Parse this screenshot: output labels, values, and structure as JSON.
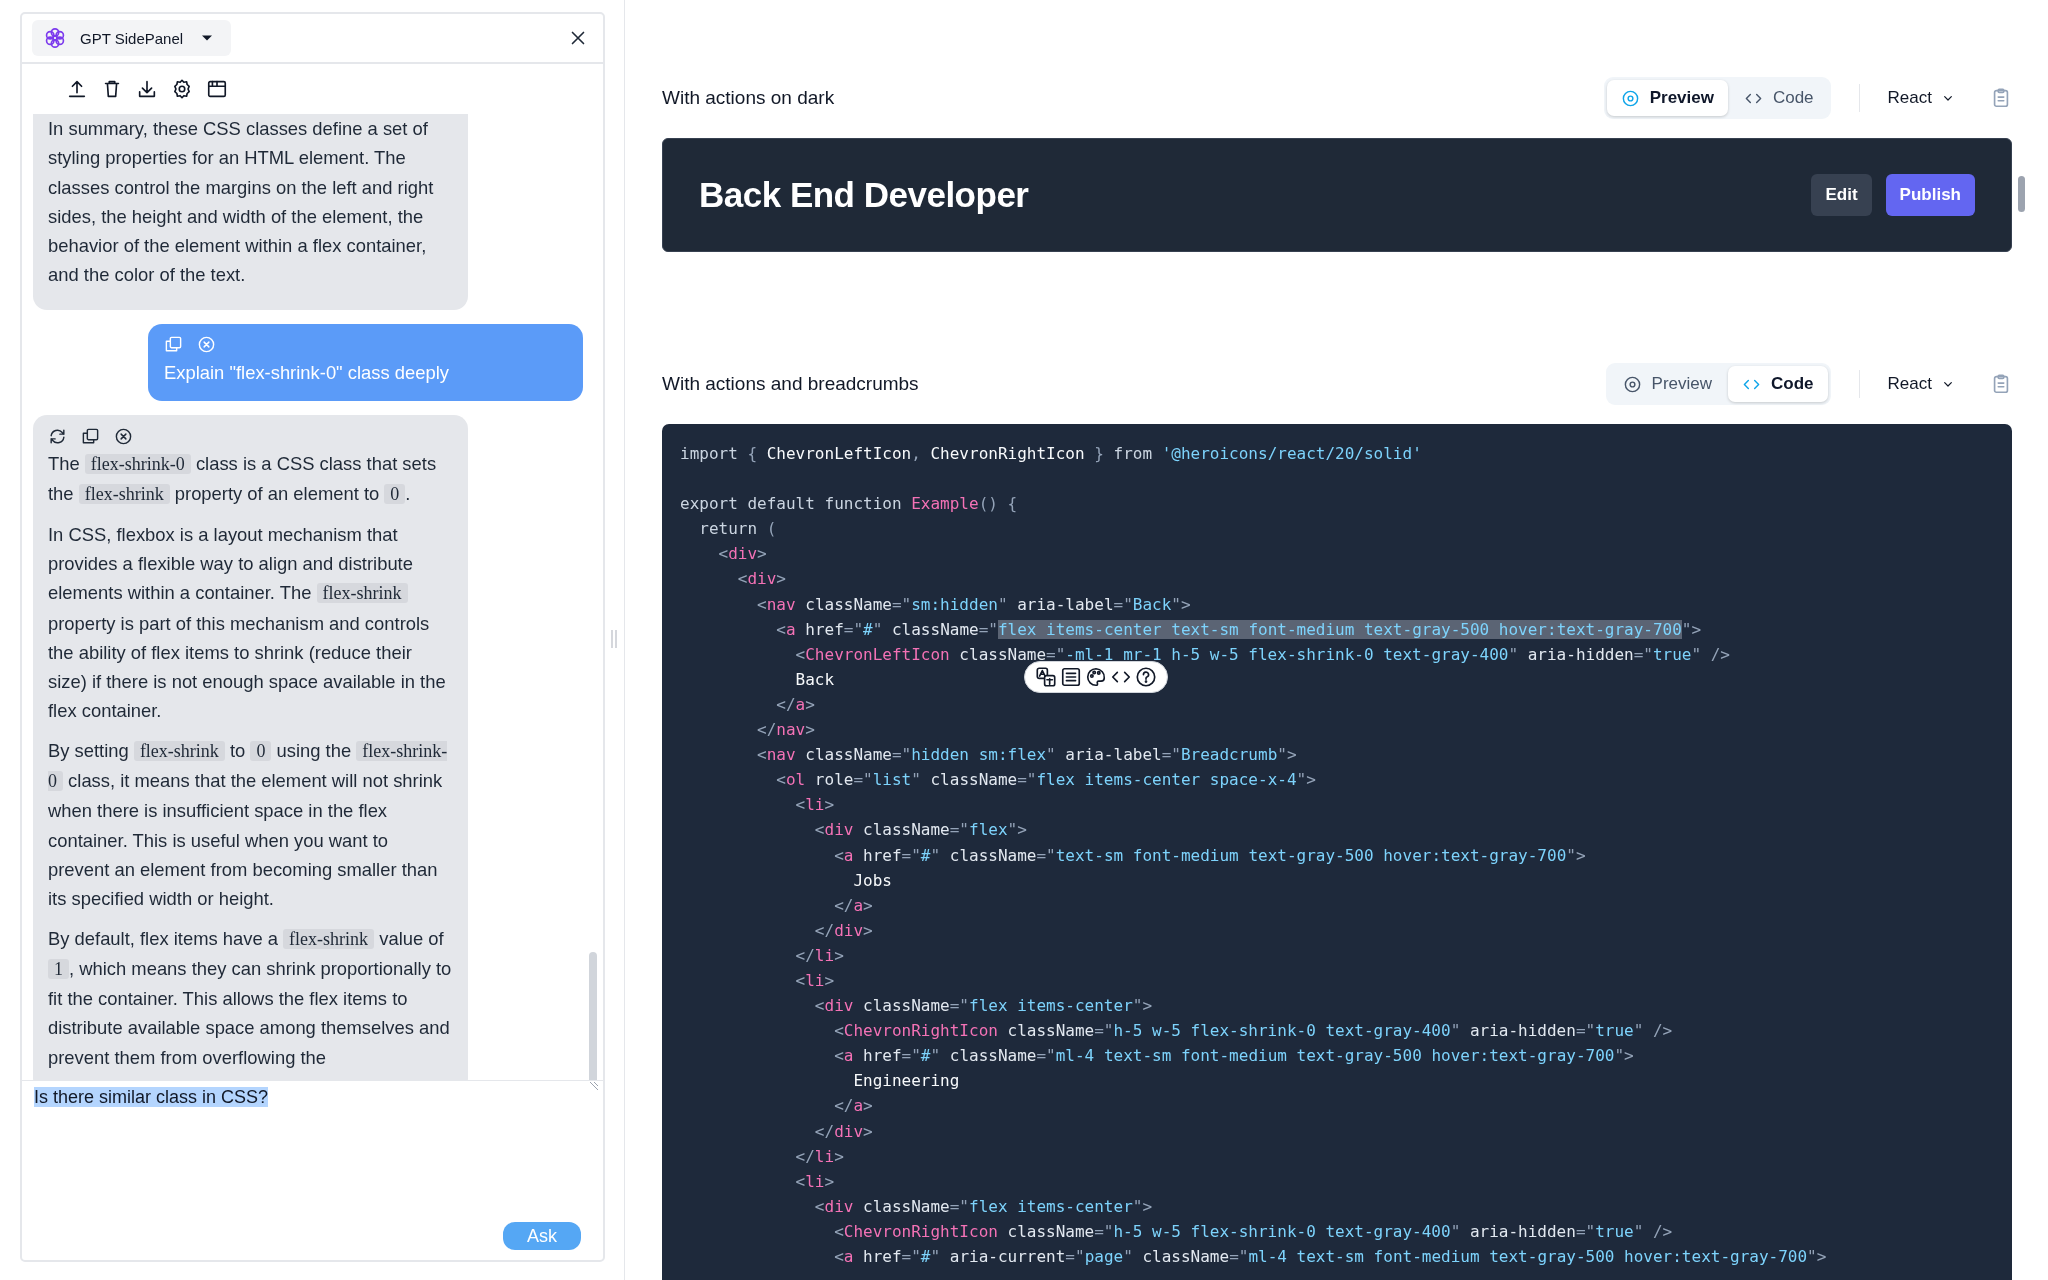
{
  "panel": {
    "title": "GPT SidePanel",
    "messages": [
      {
        "kind": "assistant",
        "cut_off_top": true,
        "paragraphs": [
          [
            {
              "kind": "text",
              "text": "In summary, these CSS classes define a set of styling properties for an HTML element. The classes control the margins on the left and right sides, the height and width of the element, the behavior of the element within a flex container, and the color of the text."
            }
          ]
        ]
      },
      {
        "kind": "user",
        "cut_off_top": false,
        "paragraphs": [
          [
            {
              "kind": "text",
              "text": "Explain \"flex-shrink-0\" class deeply"
            }
          ]
        ]
      },
      {
        "kind": "assistant",
        "cut_off_top": false,
        "paragraphs": [
          [
            {
              "kind": "text",
              "text": "The "
            },
            {
              "kind": "code",
              "text": "flex-shrink-0"
            },
            {
              "kind": "text",
              "text": " class is a CSS class that sets the "
            },
            {
              "kind": "code",
              "text": "flex-shrink"
            },
            {
              "kind": "text",
              "text": " property of an element to "
            },
            {
              "kind": "code",
              "text": "0"
            },
            {
              "kind": "text",
              "text": "."
            }
          ],
          [
            {
              "kind": "text",
              "text": "In CSS, flexbox is a layout mechanism that provides a flexible way to align and distribute elements within a container. The "
            },
            {
              "kind": "code",
              "text": "flex-shrink"
            },
            {
              "kind": "text",
              "text": " property is part of this mechanism and controls the ability of flex items to shrink (reduce their size) if there is not enough space available in the flex container."
            }
          ],
          [
            {
              "kind": "text",
              "text": "By setting "
            },
            {
              "kind": "code",
              "text": "flex-shrink"
            },
            {
              "kind": "text",
              "text": " to "
            },
            {
              "kind": "code",
              "text": "0"
            },
            {
              "kind": "text",
              "text": " using the "
            },
            {
              "kind": "code",
              "text": "flex-shrink-0"
            },
            {
              "kind": "text",
              "text": " class, it means that the element will not shrink when there is insufficient space in the flex container. This is useful when you want to prevent an element from becoming smaller than its specified width or height."
            }
          ],
          [
            {
              "kind": "text",
              "text": "By default, flex items have a "
            },
            {
              "kind": "code",
              "text": "flex-shrink"
            },
            {
              "kind": "text",
              "text": " value of "
            },
            {
              "kind": "code",
              "text": "1"
            },
            {
              "kind": "text",
              "text": ", which means they can shrink proportionally to fit the container. This allows the flex items to distribute available space among themselves and prevent them from overflowing the"
            }
          ]
        ]
      }
    ],
    "input": {
      "value": "Is there similar class in CSS?",
      "value_selected": true
    },
    "ask_button": "Ask"
  },
  "sections": [
    {
      "title": "With actions on dark",
      "kind": "preview",
      "tabs": [
        {
          "label": "Preview",
          "selected": true
        },
        {
          "label": "Code",
          "selected": false
        }
      ],
      "framework": "React",
      "preview": {
        "heading": "Back End Developer",
        "buttons": [
          {
            "label": "Edit",
            "kind": "secondary"
          },
          {
            "label": "Publish",
            "kind": "primary"
          }
        ]
      }
    },
    {
      "title": "With actions and breadcrumbs",
      "kind": "code",
      "tabs": [
        {
          "label": "Preview",
          "selected": false
        },
        {
          "label": "Code",
          "selected": true
        }
      ],
      "framework": "React",
      "code_blocks": [
        [
          [
            {
              "kind": "kw",
              "text": "import"
            },
            {
              "kind": "p",
              "text": " { "
            },
            {
              "kind": "id",
              "text": "ChevronLeftIcon"
            },
            {
              "kind": "p",
              "text": ", "
            },
            {
              "kind": "id",
              "text": "ChevronRightIcon"
            },
            {
              "kind": "p",
              "text": " } "
            },
            {
              "kind": "kw",
              "text": "from "
            },
            {
              "kind": "str",
              "text": "'@heroicons/react/20/solid'"
            }
          ]
        ],
        [
          [
            {
              "kind": "kw",
              "text": "export default function "
            },
            {
              "kind": "fn",
              "text": "Example"
            },
            {
              "kind": "p",
              "text": "() {"
            }
          ],
          [
            {
              "kind": "kw",
              "text": "  return"
            },
            {
              "kind": "p",
              "text": " ("
            }
          ],
          [
            {
              "kind": "p",
              "text": "    <"
            },
            {
              "kind": "tag",
              "text": "div"
            },
            {
              "kind": "p",
              "text": ">"
            }
          ],
          [
            {
              "kind": "p",
              "text": "      <"
            },
            {
              "kind": "tag",
              "text": "div"
            },
            {
              "kind": "p",
              "text": ">"
            }
          ],
          [
            {
              "kind": "p",
              "text": "        <"
            },
            {
              "kind": "tag",
              "text": "nav"
            },
            {
              "kind": "attr",
              "text": " className"
            },
            {
              "kind": "p",
              "text": "=\""
            },
            {
              "kind": "str",
              "text": "sm:hidden"
            },
            {
              "kind": "p",
              "text": "\""
            },
            {
              "kind": "attr",
              "text": " aria-label"
            },
            {
              "kind": "p",
              "text": "=\""
            },
            {
              "kind": "str",
              "text": "Back"
            },
            {
              "kind": "p",
              "text": "\">"
            }
          ],
          [
            {
              "kind": "p",
              "text": "          <"
            },
            {
              "kind": "tag",
              "text": "a"
            },
            {
              "kind": "attr",
              "text": " href"
            },
            {
              "kind": "p",
              "text": "=\""
            },
            {
              "kind": "str",
              "text": "#"
            },
            {
              "kind": "p",
              "text": "\""
            },
            {
              "kind": "attr",
              "text": " className"
            },
            {
              "kind": "p",
              "text": "=\""
            },
            {
              "kind": "sel",
              "text": "flex items-center text-sm font-medium text-gray-500 hover:text-gray-700"
            },
            {
              "kind": "p",
              "text": "\">"
            }
          ],
          [
            {
              "kind": "p",
              "text": "            <"
            },
            {
              "kind": "tag",
              "text": "ChevronLeftIcon"
            },
            {
              "kind": "attr",
              "text": " className"
            },
            {
              "kind": "p",
              "text": "=\""
            },
            {
              "kind": "str",
              "text": "-ml-1 mr-1 h-5 w-5 flex-shrink-0 text-gray-400"
            },
            {
              "kind": "p",
              "text": "\""
            },
            {
              "kind": "attr",
              "text": " aria-hidden"
            },
            {
              "kind": "p",
              "text": "=\""
            },
            {
              "kind": "str",
              "text": "true"
            },
            {
              "kind": "p",
              "text": "\" />"
            }
          ],
          [
            {
              "kind": "txt",
              "text": "            Back"
            }
          ],
          [
            {
              "kind": "p",
              "text": "          </"
            },
            {
              "kind": "tag",
              "text": "a"
            },
            {
              "kind": "p",
              "text": ">"
            }
          ],
          [
            {
              "kind": "p",
              "text": "        </"
            },
            {
              "kind": "tag",
              "text": "nav"
            },
            {
              "kind": "p",
              "text": ">"
            }
          ],
          [
            {
              "kind": "p",
              "text": "        <"
            },
            {
              "kind": "tag",
              "text": "nav"
            },
            {
              "kind": "attr",
              "text": " className"
            },
            {
              "kind": "p",
              "text": "=\""
            },
            {
              "kind": "str",
              "text": "hidden sm:flex"
            },
            {
              "kind": "p",
              "text": "\""
            },
            {
              "kind": "attr",
              "text": " aria-label"
            },
            {
              "kind": "p",
              "text": "=\""
            },
            {
              "kind": "str",
              "text": "Breadcrumb"
            },
            {
              "kind": "p",
              "text": "\">"
            }
          ],
          [
            {
              "kind": "p",
              "text": "          <"
            },
            {
              "kind": "tag",
              "text": "ol"
            },
            {
              "kind": "attr",
              "text": " role"
            },
            {
              "kind": "p",
              "text": "=\""
            },
            {
              "kind": "str",
              "text": "list"
            },
            {
              "kind": "p",
              "text": "\""
            },
            {
              "kind": "attr",
              "text": " className"
            },
            {
              "kind": "p",
              "text": "=\""
            },
            {
              "kind": "str",
              "text": "flex items-center space-x-4"
            },
            {
              "kind": "p",
              "text": "\">"
            }
          ],
          [
            {
              "kind": "p",
              "text": "            <"
            },
            {
              "kind": "tag",
              "text": "li"
            },
            {
              "kind": "p",
              "text": ">"
            }
          ],
          [
            {
              "kind": "p",
              "text": "              <"
            },
            {
              "kind": "tag",
              "text": "div"
            },
            {
              "kind": "attr",
              "text": " className"
            },
            {
              "kind": "p",
              "text": "=\""
            },
            {
              "kind": "str",
              "text": "flex"
            },
            {
              "kind": "p",
              "text": "\">"
            }
          ],
          [
            {
              "kind": "p",
              "text": "                <"
            },
            {
              "kind": "tag",
              "text": "a"
            },
            {
              "kind": "attr",
              "text": " href"
            },
            {
              "kind": "p",
              "text": "=\""
            },
            {
              "kind": "str",
              "text": "#"
            },
            {
              "kind": "p",
              "text": "\""
            },
            {
              "kind": "attr",
              "text": " className"
            },
            {
              "kind": "p",
              "text": "=\""
            },
            {
              "kind": "str",
              "text": "text-sm font-medium text-gray-500 hover:text-gray-700"
            },
            {
              "kind": "p",
              "text": "\">"
            }
          ],
          [
            {
              "kind": "txt",
              "text": "                  Jobs"
            }
          ],
          [
            {
              "kind": "p",
              "text": "                </"
            },
            {
              "kind": "tag",
              "text": "a"
            },
            {
              "kind": "p",
              "text": ">"
            }
          ],
          [
            {
              "kind": "p",
              "text": "              </"
            },
            {
              "kind": "tag",
              "text": "div"
            },
            {
              "kind": "p",
              "text": ">"
            }
          ],
          [
            {
              "kind": "p",
              "text": "            </"
            },
            {
              "kind": "tag",
              "text": "li"
            },
            {
              "kind": "p",
              "text": ">"
            }
          ],
          [
            {
              "kind": "p",
              "text": "            <"
            },
            {
              "kind": "tag",
              "text": "li"
            },
            {
              "kind": "p",
              "text": ">"
            }
          ],
          [
            {
              "kind": "p",
              "text": "              <"
            },
            {
              "kind": "tag",
              "text": "div"
            },
            {
              "kind": "attr",
              "text": " className"
            },
            {
              "kind": "p",
              "text": "=\""
            },
            {
              "kind": "str",
              "text": "flex items-center"
            },
            {
              "kind": "p",
              "text": "\">"
            }
          ],
          [
            {
              "kind": "p",
              "text": "                <"
            },
            {
              "kind": "tag",
              "text": "ChevronRightIcon"
            },
            {
              "kind": "attr",
              "text": " className"
            },
            {
              "kind": "p",
              "text": "=\""
            },
            {
              "kind": "str",
              "text": "h-5 w-5 flex-shrink-0 text-gray-400"
            },
            {
              "kind": "p",
              "text": "\""
            },
            {
              "kind": "attr",
              "text": " aria-hidden"
            },
            {
              "kind": "p",
              "text": "=\""
            },
            {
              "kind": "str",
              "text": "true"
            },
            {
              "kind": "p",
              "text": "\" />"
            }
          ],
          [
            {
              "kind": "p",
              "text": "                <"
            },
            {
              "kind": "tag",
              "text": "a"
            },
            {
              "kind": "attr",
              "text": " href"
            },
            {
              "kind": "p",
              "text": "=\""
            },
            {
              "kind": "str",
              "text": "#"
            },
            {
              "kind": "p",
              "text": "\""
            },
            {
              "kind": "attr",
              "text": " className"
            },
            {
              "kind": "p",
              "text": "=\""
            },
            {
              "kind": "str",
              "text": "ml-4 text-sm font-medium text-gray-500 hover:text-gray-700"
            },
            {
              "kind": "p",
              "text": "\">"
            }
          ],
          [
            {
              "kind": "txt",
              "text": "                  Engineering"
            }
          ],
          [
            {
              "kind": "p",
              "text": "                </"
            },
            {
              "kind": "tag",
              "text": "a"
            },
            {
              "kind": "p",
              "text": ">"
            }
          ],
          [
            {
              "kind": "p",
              "text": "              </"
            },
            {
              "kind": "tag",
              "text": "div"
            },
            {
              "kind": "p",
              "text": ">"
            }
          ],
          [
            {
              "kind": "p",
              "text": "            </"
            },
            {
              "kind": "tag",
              "text": "li"
            },
            {
              "kind": "p",
              "text": ">"
            }
          ],
          [
            {
              "kind": "p",
              "text": "            <"
            },
            {
              "kind": "tag",
              "text": "li"
            },
            {
              "kind": "p",
              "text": ">"
            }
          ],
          [
            {
              "kind": "p",
              "text": "              <"
            },
            {
              "kind": "tag",
              "text": "div"
            },
            {
              "kind": "attr",
              "text": " className"
            },
            {
              "kind": "p",
              "text": "=\""
            },
            {
              "kind": "str",
              "text": "flex items-center"
            },
            {
              "kind": "p",
              "text": "\">"
            }
          ],
          [
            {
              "kind": "p",
              "text": "                <"
            },
            {
              "kind": "tag",
              "text": "ChevronRightIcon"
            },
            {
              "kind": "attr",
              "text": " className"
            },
            {
              "kind": "p",
              "text": "=\""
            },
            {
              "kind": "str",
              "text": "h-5 w-5 flex-shrink-0 text-gray-400"
            },
            {
              "kind": "p",
              "text": "\""
            },
            {
              "kind": "attr",
              "text": " aria-hidden"
            },
            {
              "kind": "p",
              "text": "=\""
            },
            {
              "kind": "str",
              "text": "true"
            },
            {
              "kind": "p",
              "text": "\" />"
            }
          ],
          [
            {
              "kind": "p",
              "text": "                <"
            },
            {
              "kind": "tag",
              "text": "a"
            },
            {
              "kind": "attr",
              "text": " href"
            },
            {
              "kind": "p",
              "text": "=\""
            },
            {
              "kind": "str",
              "text": "#"
            },
            {
              "kind": "p",
              "text": "\""
            },
            {
              "kind": "attr",
              "text": " aria-current"
            },
            {
              "kind": "p",
              "text": "=\""
            },
            {
              "kind": "str",
              "text": "page"
            },
            {
              "kind": "p",
              "text": "\""
            },
            {
              "kind": "attr",
              "text": " className"
            },
            {
              "kind": "p",
              "text": "=\""
            },
            {
              "kind": "str",
              "text": "ml-4 text-sm font-medium text-gray-500 hover:text-gray-700"
            },
            {
              "kind": "p",
              "text": "\">"
            }
          ]
        ]
      ]
    }
  ]
}
